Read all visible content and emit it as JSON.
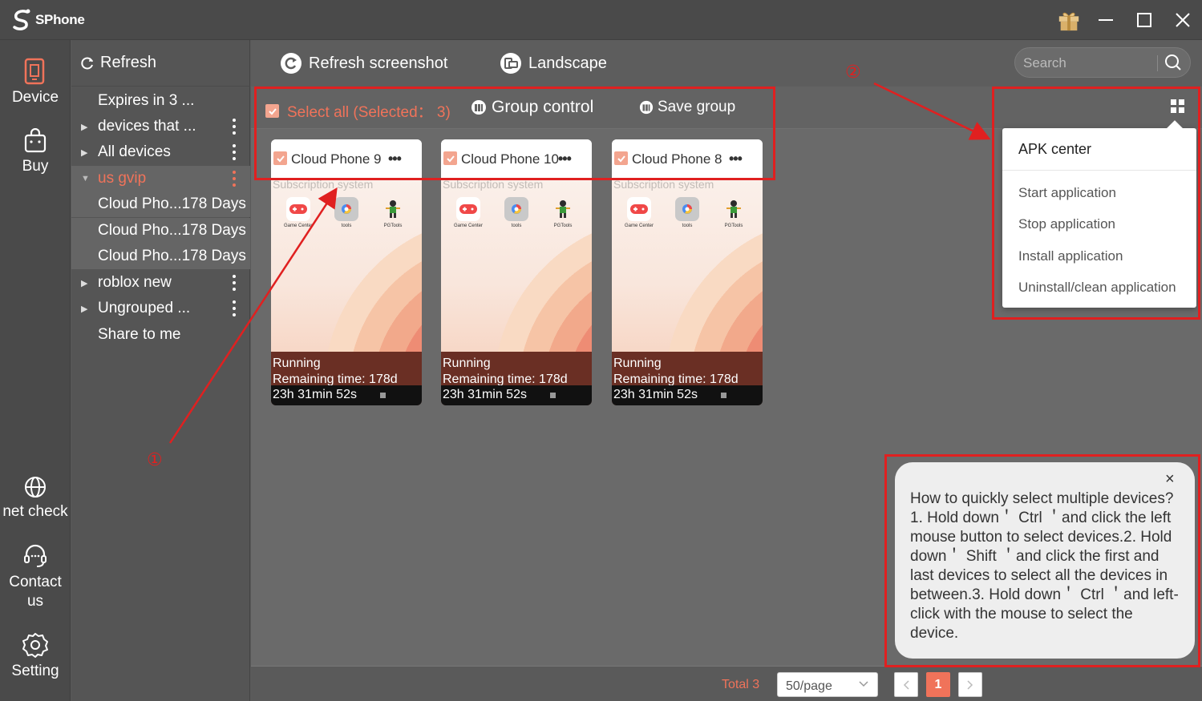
{
  "app": {
    "title": "SPhone",
    "brand_color": "#f0735a"
  },
  "leftnav": {
    "items": [
      {
        "label": "Device",
        "icon": "phone-icon"
      },
      {
        "label": "Buy",
        "icon": "shopping-bag-icon"
      },
      {
        "label": "net check",
        "icon": "globe-icon"
      },
      {
        "label": "Contact us",
        "icon": "headset-icon"
      },
      {
        "label": "Setting",
        "icon": "gear-icon"
      }
    ]
  },
  "groups": {
    "refresh_label": "Refresh",
    "items": [
      {
        "label": "Expires in 3 ...",
        "expandable": false,
        "menu": false
      },
      {
        "label": "devices that ...",
        "expandable": true,
        "menu": true
      },
      {
        "label": "All devices",
        "expandable": true,
        "menu": true
      },
      {
        "label": "us gvip",
        "expandable": true,
        "menu": true,
        "active": true
      },
      {
        "label": "Cloud Pho...178 Days"
      },
      {
        "label": "Cloud Pho...178 Days"
      },
      {
        "label": "Cloud Pho...178 Days"
      },
      {
        "label": "roblox new",
        "expandable": true,
        "menu": true
      },
      {
        "label": "Ungrouped ...",
        "expandable": true,
        "menu": true
      },
      {
        "label": "Share to me",
        "expandable": false,
        "menu": false
      }
    ]
  },
  "toolbar": {
    "refresh_screenshot": "Refresh screenshot",
    "landscape": "Landscape",
    "search_placeholder": "Search"
  },
  "actionbar": {
    "select_all": "Select all (Selected： 3)",
    "group_control": "Group control",
    "save_group": "Save group"
  },
  "devices": [
    {
      "name": "Cloud Phone 9",
      "subtitle": "Subscription system",
      "status": "Running",
      "remaining_line1": "Remaining time: 178d",
      "remaining_line2": "23h 31min 52s"
    },
    {
      "name": "Cloud Phone 10",
      "subtitle": "Subscription system",
      "status": "Running",
      "remaining_line1": "Remaining time: 178d",
      "remaining_line2": "23h 31min 52s"
    },
    {
      "name": "Cloud Phone 8",
      "subtitle": "Subscription system",
      "status": "Running",
      "remaining_line1": "Remaining time: 178d",
      "remaining_line2": "23h 31min 52s"
    }
  ],
  "apps": [
    "Game Center",
    "tools",
    "PGTools"
  ],
  "dropdown": {
    "header": "APK center",
    "items": [
      "Start application",
      "Stop application",
      "Install application",
      "Uninstall/clean application"
    ]
  },
  "tip": {
    "text": "How to quickly select multiple devices? 1. Hold down＇ Ctrl ＇and click the left mouse button to select devices.2. Hold down＇ Shift ＇and click the first and last devices to select all the devices in between.3. Hold down＇ Ctrl ＇and left-click with the mouse to select the device.",
    "close": "×"
  },
  "footer": {
    "total": "Total 3",
    "page_size": "50/page",
    "current_page": "1"
  },
  "annotations": {
    "one": "①",
    "two": "②"
  }
}
